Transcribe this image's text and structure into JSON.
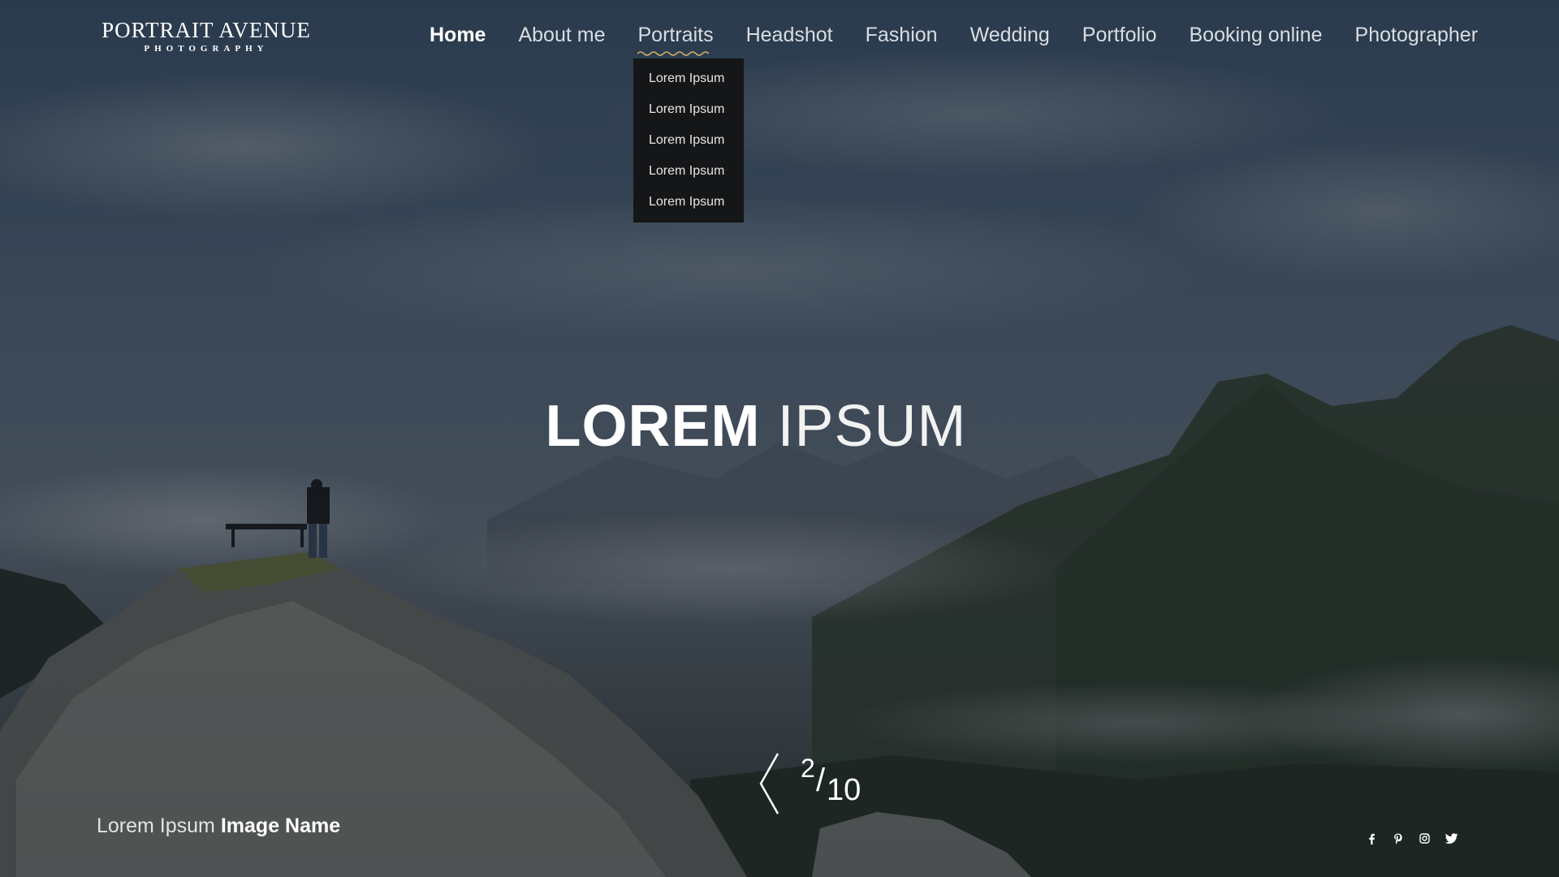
{
  "brand": {
    "name": "PORTRAIT AVENUE",
    "tagline": "PHOTOGRAPHY"
  },
  "nav": {
    "items": [
      {
        "label": "Home",
        "active": true
      },
      {
        "label": "About me"
      },
      {
        "label": "Portraits",
        "hovered": true
      },
      {
        "label": "Headshot"
      },
      {
        "label": "Fashion"
      },
      {
        "label": "Wedding"
      },
      {
        "label": "Portfolio"
      },
      {
        "label": "Booking online"
      },
      {
        "label": "Photographer"
      }
    ]
  },
  "dropdown": {
    "items": [
      "Lorem Ipsum",
      "Lorem Ipsum",
      "Lorem Ipsum",
      "Lorem Ipsum",
      "Lorem Ipsum"
    ]
  },
  "hero": {
    "title_bold": "LOREM",
    "title_light": "IPSUM"
  },
  "slider": {
    "current": "2",
    "separator": "/",
    "total": "10"
  },
  "caption": {
    "prefix": "Lorem Ipsum",
    "name": "Image Name"
  },
  "social": [
    "facebook-icon",
    "pinterest-icon",
    "instagram-icon",
    "twitter-icon"
  ],
  "colors": {
    "overlay": "#1e2a38",
    "dropdown_bg": "#151618",
    "accent_wave": "#c8a76a"
  }
}
